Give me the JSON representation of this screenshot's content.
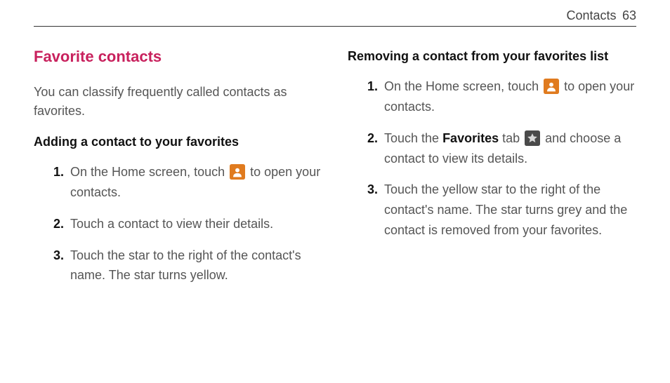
{
  "header": {
    "section": "Contacts",
    "page": "63"
  },
  "left": {
    "title": "Favorite contacts",
    "intro": "You can classify frequently called contacts as favorites.",
    "subtitle": "Adding a contact to your favorites",
    "steps": [
      {
        "num": "1.",
        "pre": "On the Home screen, touch ",
        "icon": "contacts",
        "post": " to open your contacts."
      },
      {
        "num": "2.",
        "pre": "Touch a contact to view their details.",
        "icon": null,
        "post": ""
      },
      {
        "num": "3.",
        "pre": "Touch the star to the right of the contact's name. The star turns yellow.",
        "icon": null,
        "post": ""
      }
    ]
  },
  "right": {
    "subtitle": "Removing a contact from your favorites list",
    "steps": [
      {
        "num": "1.",
        "pre": "On the Home screen, touch ",
        "icon": "contacts",
        "post": " to open your contacts."
      },
      {
        "num": "2.",
        "pre": "Touch the ",
        "bold": "Favorites",
        "mid": " tab ",
        "icon": "star",
        "post": " and choose a contact to view its details."
      },
      {
        "num": "3.",
        "pre": "Touch the yellow star to the right of the contact's name. The star turns grey and the contact is removed from your favorites.",
        "icon": null,
        "post": ""
      }
    ]
  },
  "icons": {
    "contacts": "contacts-icon",
    "star": "star-icon"
  }
}
